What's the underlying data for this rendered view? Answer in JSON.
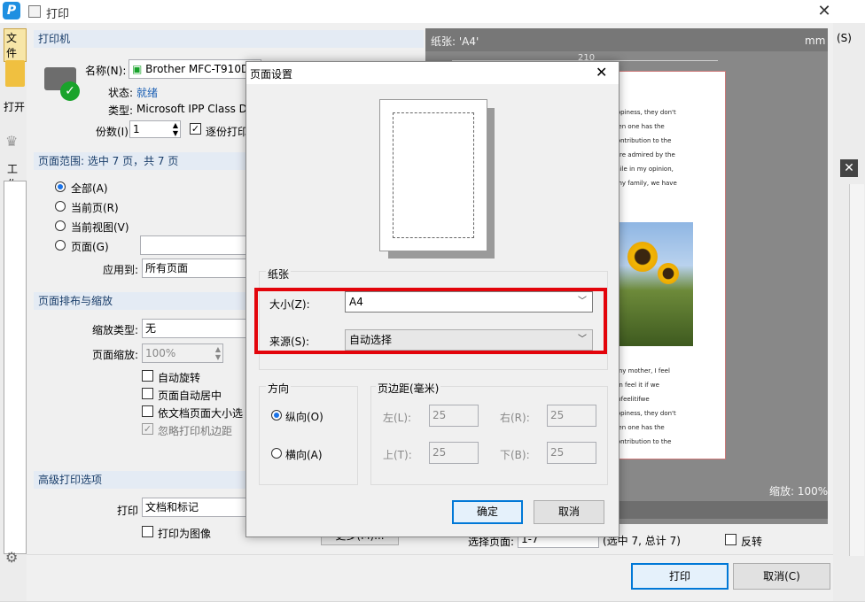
{
  "window": {
    "title": "打印",
    "app_logo_letter": "P",
    "close_glyph": "✕"
  },
  "bg_app": {
    "tab_label": "文件",
    "open_label": "打开",
    "work_label": "工作",
    "right_top": "(S)"
  },
  "printer": {
    "section_title": "打印机",
    "name_label": "名称(N):",
    "name_value": "Brother MFC-T910D",
    "status_label": "状态:",
    "status_value": "就绪",
    "type_label": "类型:",
    "type_value": "Microsoft IPP Class Dr",
    "copies_label": "份数(I):",
    "copies_value": "1",
    "collate_label": "逐份打印"
  },
  "page_range": {
    "section_title": "页面范围: 选中 7 页，共 7 页",
    "options": [
      "全部(A)",
      "当前页(R)",
      "当前视图(V)",
      "页面(G)"
    ],
    "apply_label": "应用到:",
    "apply_value": "所有页面"
  },
  "layout": {
    "section_title": "页面排布与缩放",
    "scale_type_label": "缩放类型:",
    "scale_type_value": "无",
    "page_scale_label": "页面缩放:",
    "page_scale_value": "100%",
    "checks": [
      "自动旋转",
      "页面自动居中",
      "依文档页面大小选",
      "忽略打印机边距"
    ]
  },
  "advanced": {
    "section_title": "高级打印选项",
    "print_label": "打印",
    "print_value": "文档和标记",
    "as_image_label": "打印为图像",
    "more_button": "更多(M)..."
  },
  "preview": {
    "paper_label": "纸张: 'A4'",
    "unit": "mm",
    "ruler_value": "210",
    "zoom_text": "缩放: 100%",
    "select_pages_label": "选择页面:",
    "select_pages_value": "1-7",
    "selected_info": "(选中 7, 总计 7)",
    "reverse_label": "反转",
    "doc_lines_top": [
      "of happiness, they don't",
      "at when one has the",
      "kes contribution to the",
      "acts are admired by the",
      "ns.While in my opinion,",
      "with my family, we have"
    ],
    "doc_lines_bottom": [
      "d by my mother, I feel",
      "we can feel it if we",
      "wecanfeelitifwe",
      "of happiness, they don't",
      "at when one has the",
      "kes contribution to the"
    ]
  },
  "footer": {
    "print_button": "打印",
    "cancel_button": "取消(C)"
  },
  "page_setup": {
    "title": "页面设置",
    "close_glyph": "✕",
    "paper_group": "纸张",
    "size_label": "大小(Z):",
    "size_value": "A4",
    "source_label": "来源(S):",
    "source_value": "自动选择",
    "orientation_group": "方向",
    "portrait_label": "纵向(O)",
    "landscape_label": "横向(A)",
    "margins_group": "页边距(毫米)",
    "left_label": "左(L):",
    "left_value": "25",
    "right_label": "右(R):",
    "right_value": "25",
    "top_label": "上(T):",
    "top_value": "25",
    "bottom_label": "下(B):",
    "bottom_value": "25",
    "ok_button": "确定",
    "cancel_button": "取消"
  },
  "colors": {
    "highlight_red": "#e3040b",
    "accent_blue": "#0078d7",
    "group_header_bg": "#e4ebf4"
  }
}
